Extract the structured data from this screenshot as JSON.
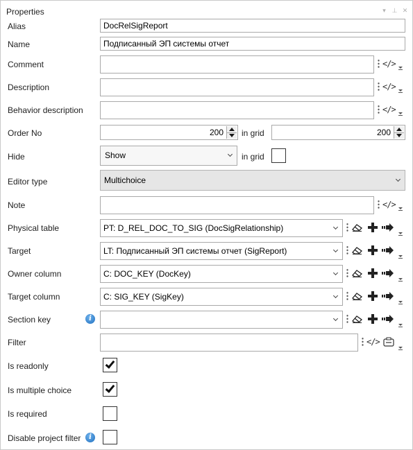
{
  "panel": {
    "title": "Properties"
  },
  "fields": {
    "alias": {
      "label": "Alias",
      "value": "DocRelSigReport"
    },
    "name": {
      "label": "Name",
      "value": "Подписанный ЭП системы отчет"
    },
    "comment": {
      "label": "Comment",
      "value": ""
    },
    "description": {
      "label": "Description",
      "value": ""
    },
    "behavior_description": {
      "label": "Behavior description",
      "value": ""
    },
    "order_no": {
      "label": "Order No",
      "value": "200",
      "grid_label": "in grid",
      "grid_value": "200"
    },
    "hide": {
      "label": "Hide",
      "value": "Show",
      "grid_label": "in grid",
      "grid_checked": false
    },
    "editor_type": {
      "label": "Editor type",
      "value": "Multichoice"
    },
    "note": {
      "label": "Note",
      "value": ""
    },
    "physical_table": {
      "label": "Physical table",
      "value": "PT: D_REL_DOC_TO_SIG (DocSigRelationship)"
    },
    "target": {
      "label": "Target",
      "value": "LT: Подписанный ЭП системы отчет (SigReport)"
    },
    "owner_column": {
      "label": "Owner column",
      "value": "C: DOC_KEY (DocKey)"
    },
    "target_column": {
      "label": "Target column",
      "value": "C: SIG_KEY (SigKey)"
    },
    "section_key": {
      "label": "Section key",
      "value": ""
    },
    "filter": {
      "label": "Filter",
      "value": ""
    },
    "is_readonly": {
      "label": "Is readonly",
      "checked": true
    },
    "is_multiple_choice": {
      "label": "Is multiple choice",
      "checked": true
    },
    "is_required": {
      "label": "Is required",
      "checked": false
    },
    "disable_project_filter": {
      "label": "Disable project filter",
      "checked": false
    }
  },
  "icons": {
    "code": "</>",
    "info": "i"
  },
  "colors": {
    "border": "#a9a9a9",
    "info_blue": "#1f6fbf",
    "gray_combo": "#e6e6e6"
  }
}
